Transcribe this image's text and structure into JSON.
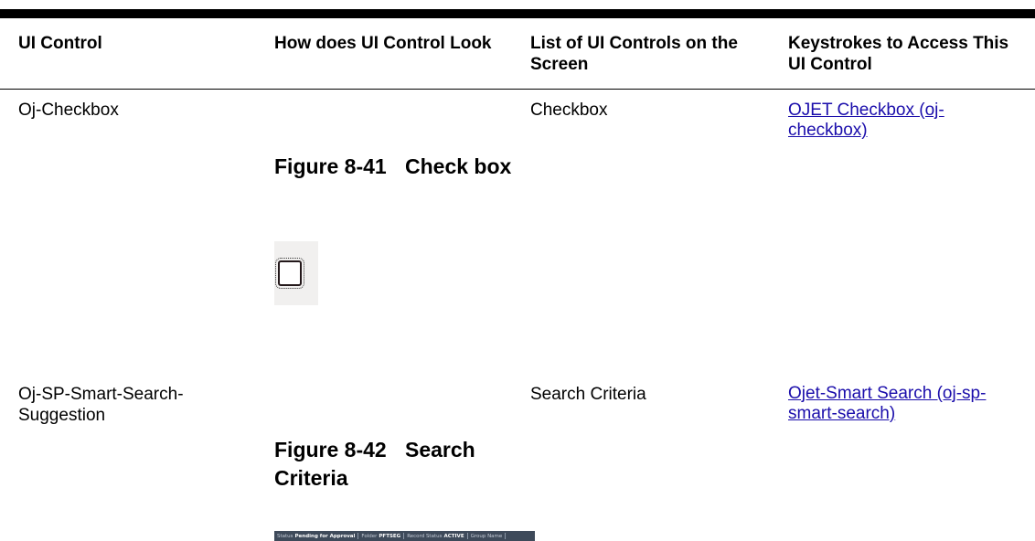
{
  "headers": [
    "UI Control",
    "How does UI Control Look",
    "List of UI Controls on the Screen",
    "Keystrokes to Access This UI Control"
  ],
  "rows": [
    {
      "control": "Oj-Checkbox",
      "figure_number": "Figure 8-41",
      "figure_title": "Check box",
      "list": "Checkbox",
      "link": "OJET Checkbox (oj-checkbox)"
    },
    {
      "control": "Oj-SP-Smart-Search-Suggestion",
      "figure_number": "Figure 8-42",
      "figure_title": "Search Criteria",
      "list": "Search Criteria",
      "link": "Ojet-Smart Search (oj-sp-smart-search)"
    }
  ],
  "search_strip": [
    {
      "label": "Status",
      "value": "Pending for Approval"
    },
    {
      "label": "Folder",
      "value": "PFTSEG"
    },
    {
      "label": "Record Status",
      "value": "ACTIVE"
    },
    {
      "label": "Group Name",
      "value": ""
    }
  ]
}
